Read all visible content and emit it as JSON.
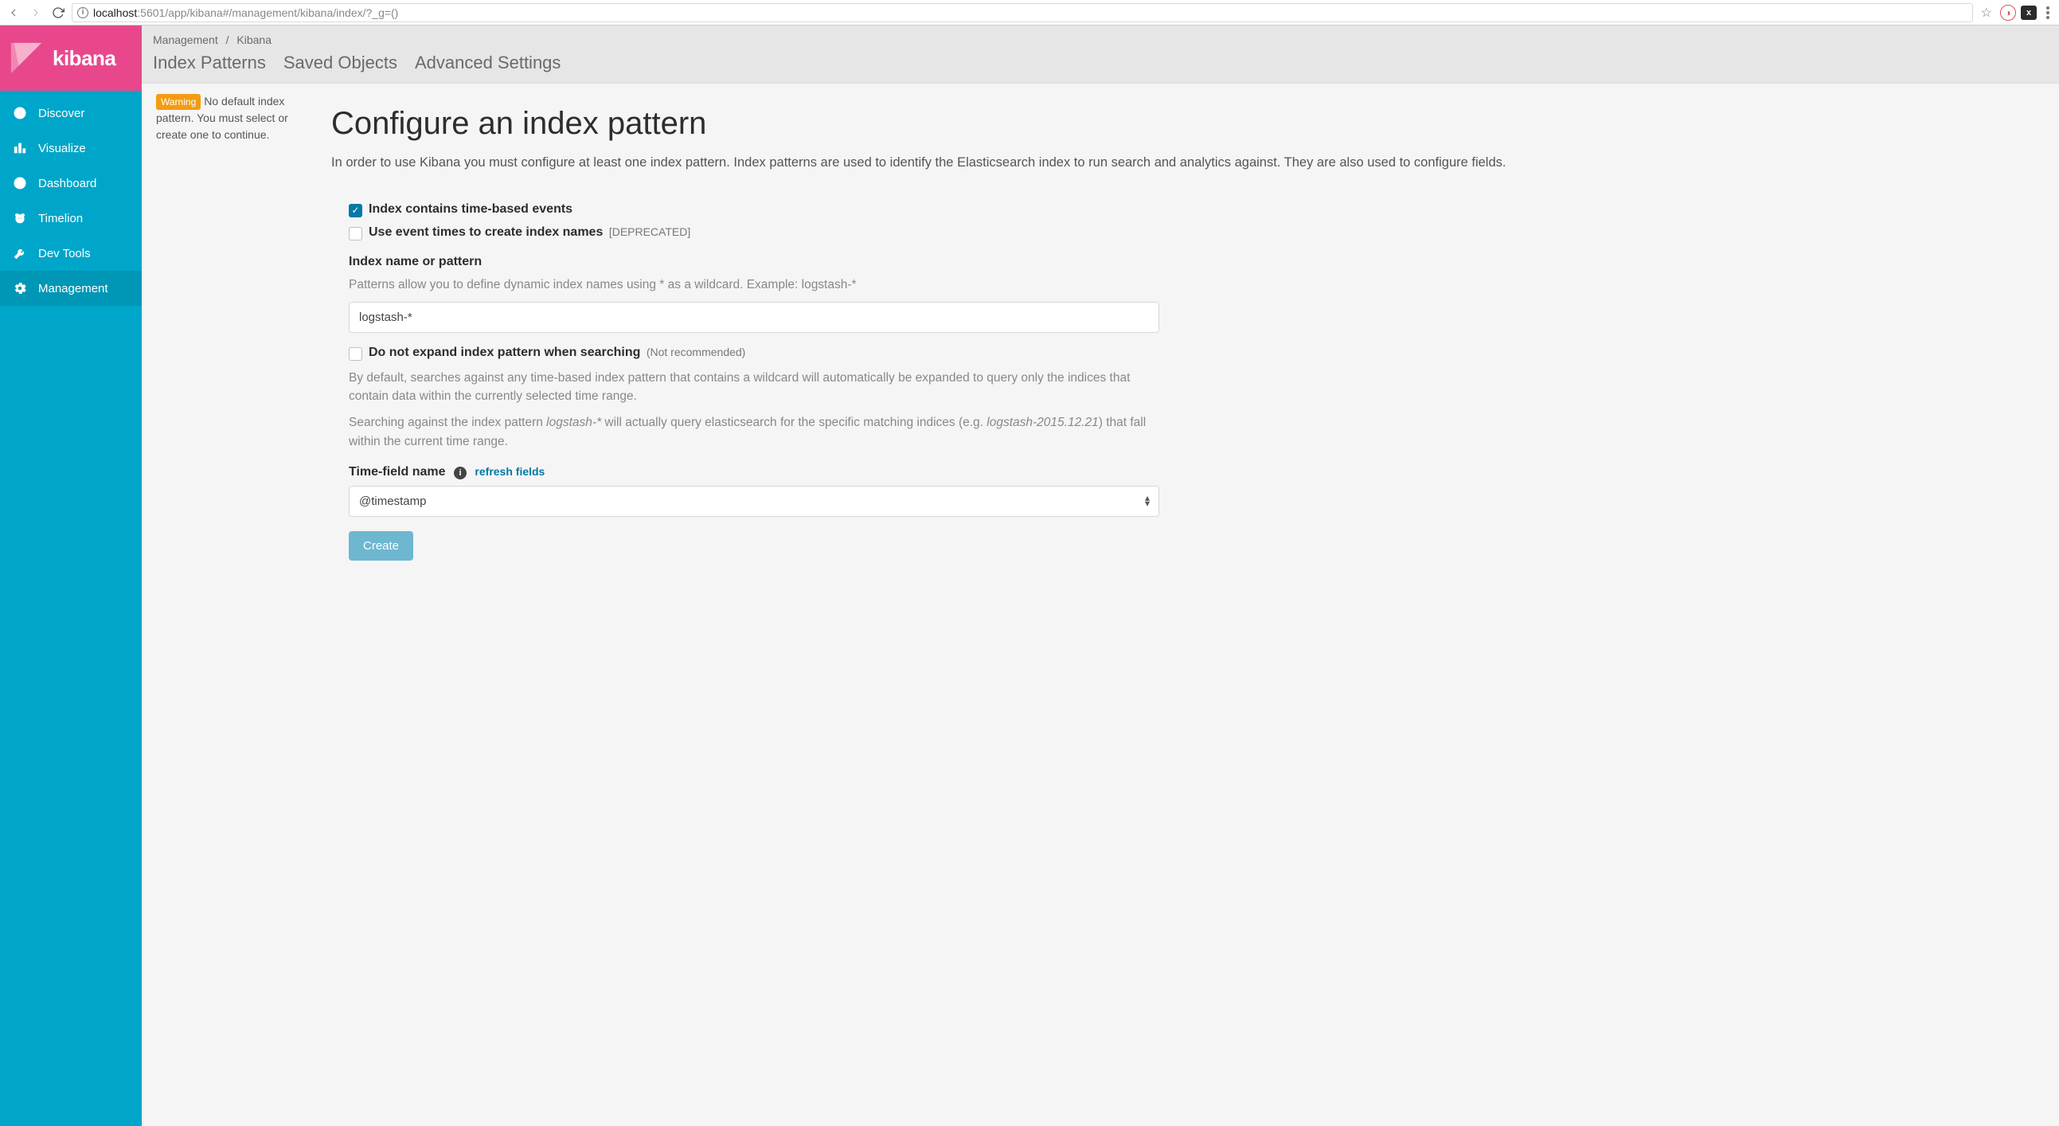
{
  "browser": {
    "host": "localhost",
    "port": ":5601",
    "path": "/app/kibana#/management/kibana/index/?_g=()"
  },
  "brand": "kibana",
  "nav": {
    "items": [
      {
        "label": "Discover"
      },
      {
        "label": "Visualize"
      },
      {
        "label": "Dashboard"
      },
      {
        "label": "Timelion"
      },
      {
        "label": "Dev Tools"
      },
      {
        "label": "Management"
      }
    ]
  },
  "breadcrumbs": {
    "management": "Management",
    "kibana": "Kibana"
  },
  "tabs": {
    "index_patterns": "Index Patterns",
    "saved_objects": "Saved Objects",
    "advanced_settings": "Advanced Settings"
  },
  "warning": {
    "badge": "Warning",
    "text": "No default index pattern. You must select or create one to continue."
  },
  "page": {
    "title": "Configure an index pattern",
    "intro": "In order to use Kibana you must configure at least one index pattern. Index patterns are used to identify the Elasticsearch index to run search and analytics against. They are also used to configure fields."
  },
  "form": {
    "time_based_label": "Index contains time-based events",
    "event_times_label": "Use event times to create index names",
    "event_times_suffix": "[DEPRECATED]",
    "index_name_label": "Index name or pattern",
    "index_name_help": "Patterns allow you to define dynamic index names using * as a wildcard. Example: logstash-*",
    "index_name_value": "logstash-*",
    "no_expand_label": "Do not expand index pattern when searching",
    "no_expand_suffix": "(Not recommended)",
    "expand_help1": "By default, searches against any time-based index pattern that contains a wildcard will automatically be expanded to query only the indices that contain data within the currently selected time range.",
    "expand_help2a": "Searching against the index pattern ",
    "expand_help2_em1": "logstash-*",
    "expand_help2b": " will actually query elasticsearch for the specific matching indices (e.g. ",
    "expand_help2_em2": "logstash-2015.12.21",
    "expand_help2c": ") that fall within the current time range.",
    "time_field_label": "Time-field name",
    "refresh_fields": "refresh fields",
    "time_field_value": "@timestamp",
    "create_button": "Create"
  }
}
